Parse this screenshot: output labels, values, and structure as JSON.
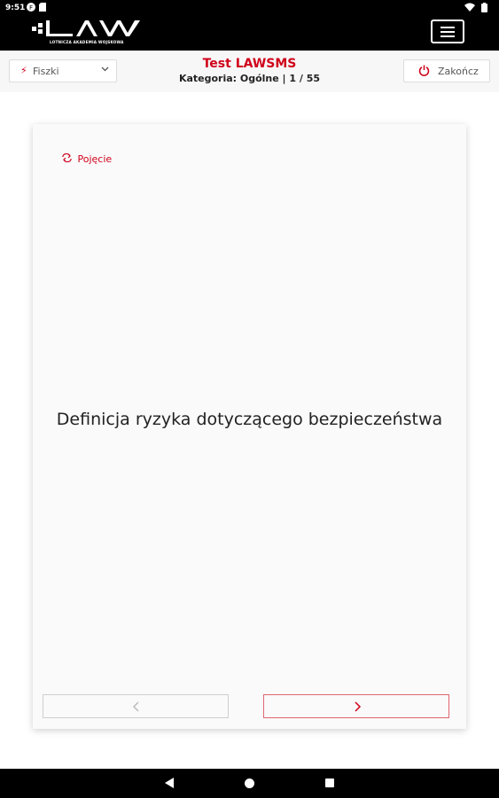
{
  "status_bar": {
    "time": "9:51",
    "icons": [
      "app-f-icon",
      "sim-icon",
      "wifi-icon",
      "battery-icon"
    ]
  },
  "app_bar": {
    "logo_text": "LAW",
    "logo_subtitle": "LOTNICZA AKADEMIA WOJSKOWA",
    "menu_icon": "hamburger-menu-icon"
  },
  "toolbar": {
    "mode_select": {
      "selected": "Fiszki",
      "icon": "bolt-icon"
    },
    "test_title": "Test LAWSMS",
    "category_line": "Kategoria: Ogólne | 1 / 55",
    "end_button": {
      "label": "Zakończ",
      "icon": "power-icon"
    }
  },
  "card": {
    "side_toggle_label": "Pojęcie",
    "question_text": "Definicja ryzyka dotyczącego bezpieczeństwa",
    "prev_icon": "chevron-left-icon",
    "next_icon": "chevron-right-icon"
  },
  "colors": {
    "accent": "#d0021b",
    "appbar_bg": "#000000",
    "card_bg": "#fafafa"
  }
}
